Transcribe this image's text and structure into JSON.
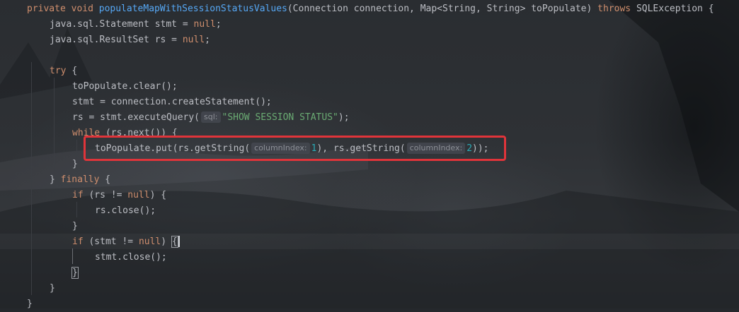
{
  "editor": {
    "lines": [
      {
        "tokens": [
          {
            "t": "private void ",
            "c": "kw"
          },
          {
            "t": "populateMapWithSessionStatusValues",
            "c": "fn"
          },
          {
            "t": "(Connection connection, Map<String, String> toPopulate) "
          },
          {
            "t": "throws ",
            "c": "kw"
          },
          {
            "t": "SQLException {"
          }
        ]
      },
      {
        "tokens": [
          {
            "t": "java.sql.Statement stmt = "
          },
          {
            "t": "null",
            "c": "kw"
          },
          {
            "t": ";"
          }
        ]
      },
      {
        "tokens": [
          {
            "t": "java.sql.ResultSet rs = "
          },
          {
            "t": "null",
            "c": "kw"
          },
          {
            "t": ";"
          }
        ]
      },
      {
        "tokens": []
      },
      {
        "tokens": [
          {
            "t": "try ",
            "c": "kw"
          },
          {
            "t": "{"
          }
        ]
      },
      {
        "tokens": [
          {
            "t": "toPopulate.clear();"
          }
        ]
      },
      {
        "tokens": [
          {
            "t": "stmt = connection.createStatement();"
          }
        ]
      },
      {
        "tokens": [
          {
            "t": "rs = stmt.executeQuery("
          },
          {
            "t": "sql:",
            "c": "hint"
          },
          {
            "t": "\"SHOW SESSION STATUS\"",
            "c": "str"
          },
          {
            "t": ");"
          }
        ]
      },
      {
        "tokens": [
          {
            "t": "while ",
            "c": "kw"
          },
          {
            "t": "(rs.next()) {"
          }
        ]
      },
      {
        "tokens": [
          {
            "t": "toPopulate.put(rs.getString("
          },
          {
            "t": "columnIndex:",
            "c": "hint"
          },
          {
            "t": "1",
            "c": "num"
          },
          {
            "t": "), rs.getString("
          },
          {
            "t": "columnIndex:",
            "c": "hint"
          },
          {
            "t": "2",
            "c": "num"
          },
          {
            "t": "));"
          }
        ]
      },
      {
        "tokens": [
          {
            "t": "}"
          }
        ]
      },
      {
        "tokens": [
          {
            "t": "} "
          },
          {
            "t": "finally ",
            "c": "kw"
          },
          {
            "t": "{"
          }
        ]
      },
      {
        "tokens": [
          {
            "t": "if ",
            "c": "kw"
          },
          {
            "t": "(rs != "
          },
          {
            "t": "null",
            "c": "kw"
          },
          {
            "t": ") {"
          }
        ]
      },
      {
        "tokens": [
          {
            "t": "rs.close();"
          }
        ]
      },
      {
        "tokens": [
          {
            "t": "}"
          }
        ]
      },
      {
        "tokens": [
          {
            "t": "if ",
            "c": "kw"
          },
          {
            "t": "(stmt != "
          },
          {
            "t": "null",
            "c": "kw"
          },
          {
            "t": ") "
          },
          {
            "t": "{",
            "c": "brace-hl"
          }
        ]
      },
      {
        "tokens": [
          {
            "t": "stmt.close();"
          }
        ]
      },
      {
        "tokens": [
          {
            "t": "}",
            "c": "brace-hl"
          }
        ]
      },
      {
        "tokens": [
          {
            "t": "}"
          }
        ]
      },
      {
        "tokens": [
          {
            "t": "}"
          }
        ]
      }
    ],
    "colors": {
      "keyword": "#cf8e6d",
      "method": "#56a8f5",
      "string": "#6aab73",
      "number": "#2aacb8",
      "text": "#bcbec4",
      "annotation_box": "#e0343a"
    }
  }
}
